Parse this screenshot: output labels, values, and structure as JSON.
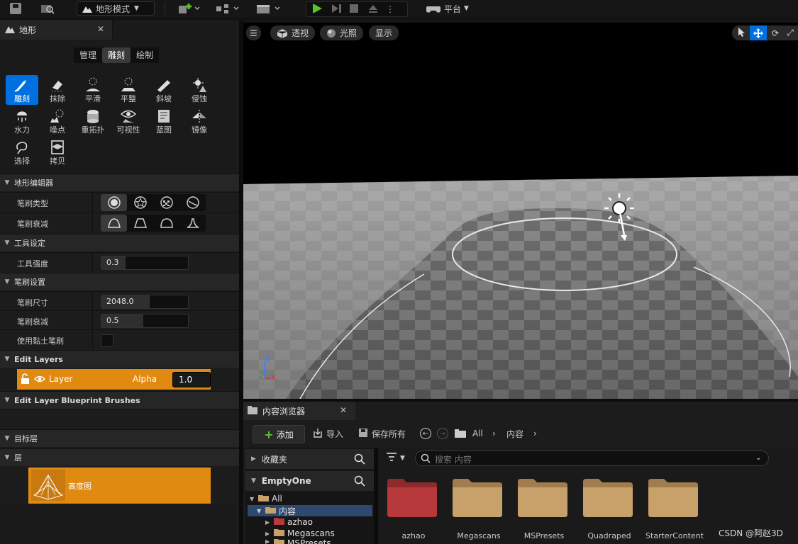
{
  "toolbar": {
    "mode": "地形模式",
    "platform": "平台"
  },
  "panel": {
    "title": "地形",
    "tabs": [
      "管理",
      "雕刻",
      "绘制"
    ],
    "active_tab": 1,
    "tools": [
      "雕刻",
      "抹除",
      "平滑",
      "平整",
      "斜坡",
      "侵蚀",
      "水力",
      "噪点",
      "重拓扑",
      "可视性",
      "蓝图",
      "镜像",
      "选择",
      "拷贝"
    ],
    "sections": {
      "editor": "地形编辑器",
      "tool_settings": "工具设定",
      "brush_settings": "笔刷设置",
      "edit_layers": "Edit Layers",
      "blueprint_brushes": "Edit Layer Blueprint Brushes",
      "target_layers": "目标层",
      "layers": "层"
    },
    "props": {
      "brush_type": "笔刷类型",
      "brush_falloff_type": "笔刷衰减",
      "tool_strength": "工具强度",
      "tool_strength_value": "0.3",
      "brush_size": "笔刷尺寸",
      "brush_size_value": "2048.0",
      "brush_falloff": "笔刷衰减",
      "brush_falloff_value": "0.5",
      "clay_brush": "使用黏土笔刷"
    },
    "layer_row": {
      "name": "Layer",
      "alpha_label": "Alpha",
      "alpha_value": "1.0"
    },
    "heightmap": "高度图"
  },
  "viewport": {
    "perspective": "透视",
    "lighting": "光照",
    "show": "显示",
    "axis_z": "Z",
    "axis_x": "X"
  },
  "content_browser": {
    "title": "内容浏览器",
    "add": "添加",
    "import": "导入",
    "save_all": "保存所有",
    "breadcrumb": [
      "All",
      "内容"
    ],
    "favorites": "收藏夹",
    "project": "EmptyOne",
    "search_placeholder": "搜索 内容",
    "tree": [
      "All",
      "内容",
      "azhao",
      "Megascans",
      "MSPresets"
    ],
    "folders": [
      "azhao",
      "Megascans",
      "MSPresets",
      "Quadraped",
      "StarterContent"
    ]
  },
  "watermark": "CSDN @阿赵3D",
  "colors": {
    "accent_blue": "#0070e0",
    "layer_orange": "#e08a12",
    "play_green": "#58c428",
    "folder_tan": "#c8a06a",
    "folder_red": "#b8393b"
  }
}
